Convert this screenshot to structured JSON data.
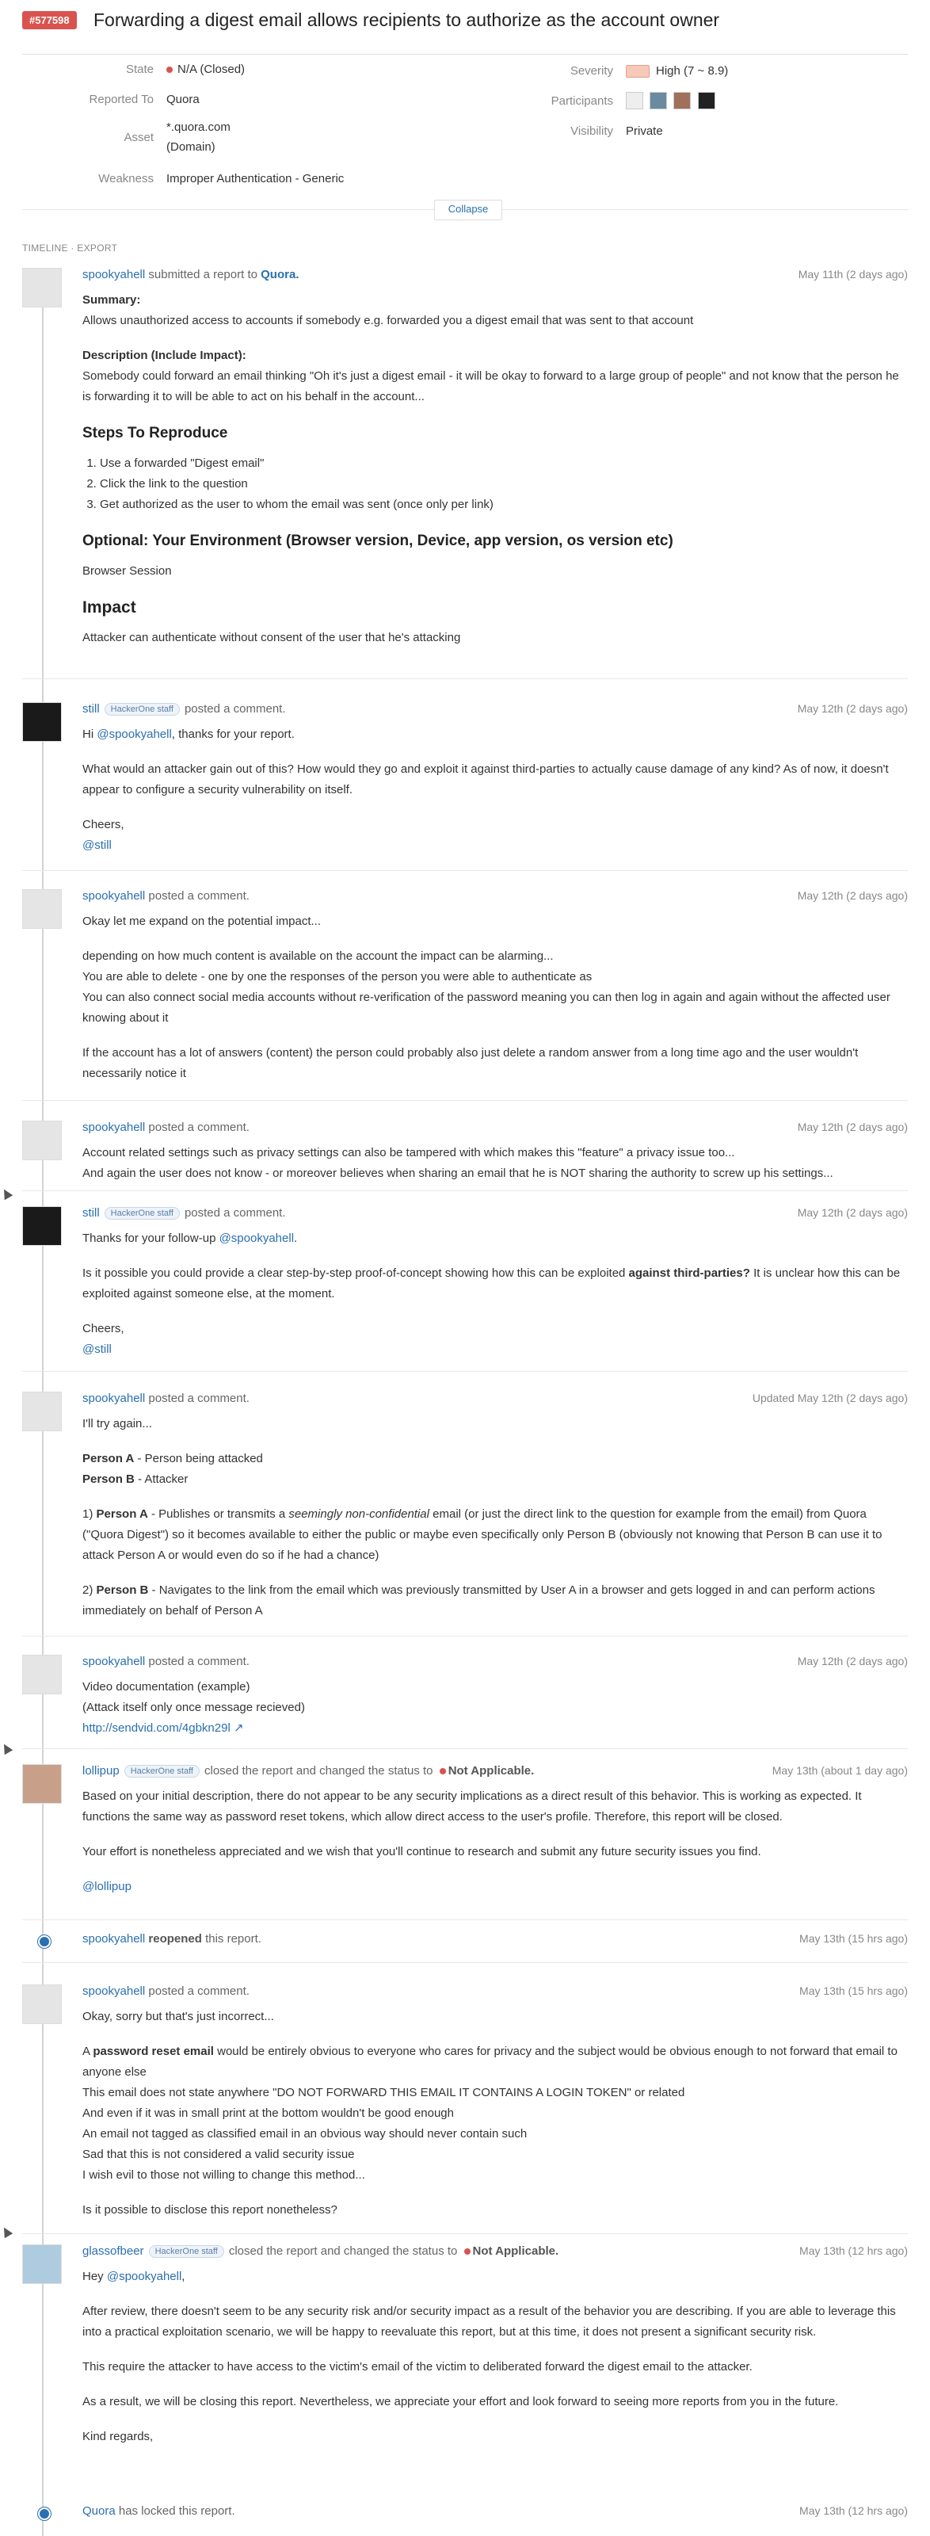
{
  "report": {
    "id_badge": "#577598",
    "title": "Forwarding a digest email allows recipients to authorize as the account owner"
  },
  "meta": {
    "state_label": "State",
    "state_value": "N/A (Closed)",
    "reported_to_label": "Reported To",
    "reported_to_value": "Quora",
    "asset_label": "Asset",
    "asset_value": "*.quora.com",
    "asset_type": "(Domain)",
    "weakness_label": "Weakness",
    "weakness_value": "Improper Authentication - Generic",
    "severity_label": "Severity",
    "severity_value": "High (7 ~ 8.9)",
    "participants_label": "Participants",
    "visibility_label": "Visibility",
    "visibility_value": "Private",
    "collapse_label": "Collapse"
  },
  "timeline": {
    "header": "TIMELINE · EXPORT"
  },
  "entries": [
    {
      "author": "spookyahell",
      "action": "submitted a report to",
      "target": "Quora.",
      "date": "May 11th (2 days ago)",
      "summary_label": "Summary:",
      "summary": "Allows unauthorized access to accounts if somebody e.g. forwarded you a digest email that was sent to that account",
      "desc_label": "Description (Include Impact):",
      "desc": "Somebody could forward an email thinking \"Oh it's just a digest email - it will be okay to forward to a large group of people\" and not know that the person he is forwarding it to will be able to act on his behalf in the account...",
      "steps_heading": "Steps To Reproduce",
      "step1": "Use a forwarded \"Digest email\"",
      "step2": "Click the link to the question",
      "step3": "Get authorized as the user to whom the email was sent (once only per link)",
      "env_heading": "Optional: Your Environment (Browser version, Device, app version, os version etc)",
      "env": "Browser Session",
      "impact_heading": "Impact",
      "impact": "Attacker can authenticate without consent of the user that he's attacking"
    },
    {
      "author": "still",
      "staff": "HackerOne staff",
      "action": "posted a comment.",
      "date": "May 12th (2 days ago)",
      "p1a": "Hi ",
      "p1mention": "@spookyahell",
      "p1b": ", thanks for your report.",
      "p2": "What would an attacker gain out of this? How would they go and exploit it against third-parties to actually cause damage of any kind? As of now, it doesn't appear to configure a security vulnerability on itself.",
      "p3": "Cheers,",
      "sig": "@still"
    },
    {
      "author": "spookyahell",
      "action": "posted a comment.",
      "date": "May 12th (2 days ago)",
      "p1": "Okay let me expand on the potential impact...",
      "p2a": "depending on how much content is available on the account the impact can be alarming...",
      "p2b": "You are able to delete - one by one the responses of the person you were able to authenticate as",
      "p2c": "You can also connect social media accounts without re-verification of the password meaning you can then log in again and again without the affected user knowing about it",
      "p3": "If the account has a lot of answers (content) the person could probably also just delete a random answer from a long time ago and the user wouldn't necessarily notice it"
    },
    {
      "author": "spookyahell",
      "action": "posted a comment.",
      "date": "May 12th (2 days ago)",
      "p1a": "Account related settings such as privacy settings can also be tampered with which makes this \"feature\" a privacy issue too...",
      "p1b": "And again the user does not know - or moreover believes when sharing an email that he is NOT sharing the authority to screw up his settings..."
    },
    {
      "author": "still",
      "staff": "HackerOne staff",
      "action": "posted a comment.",
      "date": "May 12th (2 days ago)",
      "p1a": "Thanks for your follow-up ",
      "p1mention": "@spookyahell",
      "p1b": ".",
      "p2a": "Is it possible you could provide a clear step-by-step proof-of-concept showing how this can be exploited ",
      "p2bold": "against third-parties?",
      "p2b": " It is unclear how this can be exploited against someone else, at the moment.",
      "p3": "Cheers,",
      "sig": "@still"
    },
    {
      "author": "spookyahell",
      "action": "posted a comment.",
      "date": "Updated May 12th (2 days ago)",
      "p1": "I'll try again...",
      "pa_bold": "Person A",
      "pa": " - Person being attacked",
      "pb_bold": "Person B",
      "pb": " - Attacker",
      "s1_num": "1) ",
      "s1_bold": "Person A",
      "s1a": " - Publishes or transmits a ",
      "s1_italic": "seemingly non-confidential",
      "s1b": " email (or just the direct link to the question for example from the email) from Quora (\"Quora Digest\") so it becomes available to either the public or maybe even specifically only Person B (obviously not knowing that Person B can use it to attack Person A or would even do so if he had a chance)",
      "s2_num": "2) ",
      "s2_bold": "Person B",
      "s2": " - Navigates to the link from the email which was previously transmitted by User A in a browser and gets logged in and can perform actions immediately on behalf of Person A"
    },
    {
      "author": "spookyahell",
      "action": "posted a comment.",
      "date": "May 12th (2 days ago)",
      "p1": "Video documentation (example)",
      "p2": "(Attack itself only once message recieved)",
      "link": "http://sendvid.com/4gbkn29l"
    },
    {
      "author": "lollipup",
      "staff": "HackerOne staff",
      "action": "closed the report and changed the status to",
      "status": "Not Applicable.",
      "date": "May 13th (about 1 day ago)",
      "p1": "Based on your initial description, there do not appear to be any security implications as a direct result of this behavior. This is working as expected. It functions the same way as password reset tokens, which allow direct access to the user's profile. Therefore, this report will be closed.",
      "p2": "Your effort is nonetheless appreciated and we wish that you'll continue to research and submit any future security issues you find.",
      "sig": "@lollipup"
    },
    {
      "author": "spookyahell",
      "action": "reopened",
      "action_tail": "this report.",
      "date": "May 13th (15 hrs ago)"
    },
    {
      "author": "spookyahell",
      "action": "posted a comment.",
      "date": "May 13th (15 hrs ago)",
      "p1": "Okay, sorry but that's just incorrect...",
      "l1a": "A ",
      "l1bold": "password reset email",
      "l1b": " would be entirely obvious to everyone who cares for privacy and the subject would be obvious enough to not forward that email to anyone else",
      "l2": "This email does not state anywhere \"DO NOT FORWARD THIS EMAIL IT CONTAINS A LOGIN TOKEN\" or related",
      "l3": "And even if it was in small print at the bottom wouldn't be good enough",
      "l4": "An email not tagged as classified email in an obvious way should never contain such",
      "l5": "Sad that this is not considered a valid security issue",
      "l6": "I wish evil to those not willing to change this method...",
      "p3": "Is it possible to disclose this report nonetheless?"
    },
    {
      "author": "glassofbeer",
      "staff": "HackerOne staff",
      "action": "closed the report and changed the status to",
      "status": "Not Applicable.",
      "date": "May 13th (12 hrs ago)",
      "p1a": "Hey ",
      "p1mention": "@spookyahell",
      "p1b": ",",
      "p2": "After review, there doesn't seem to be any security risk and/or security impact as a result of the behavior you are describing. If you are able to leverage this into a practical exploitation scenario, we will be happy to reevaluate this report, but at this time, it does not present a significant security risk.",
      "p3": "This require the attacker to have access to the victim's email of the victim to deliberated forward the digest email to the attacker.",
      "p4": "As a result, we will be closing this report. Nevertheless, we appreciate your effort and look forward to seeing more reports from you in the future.",
      "p5": "Kind regards,"
    },
    {
      "author": "Quora",
      "action": "has locked this report.",
      "date": "May 13th (12 hrs ago)"
    }
  ],
  "colors": {
    "brand_red": "#d9534f",
    "link_blue": "#2a6fb0"
  }
}
